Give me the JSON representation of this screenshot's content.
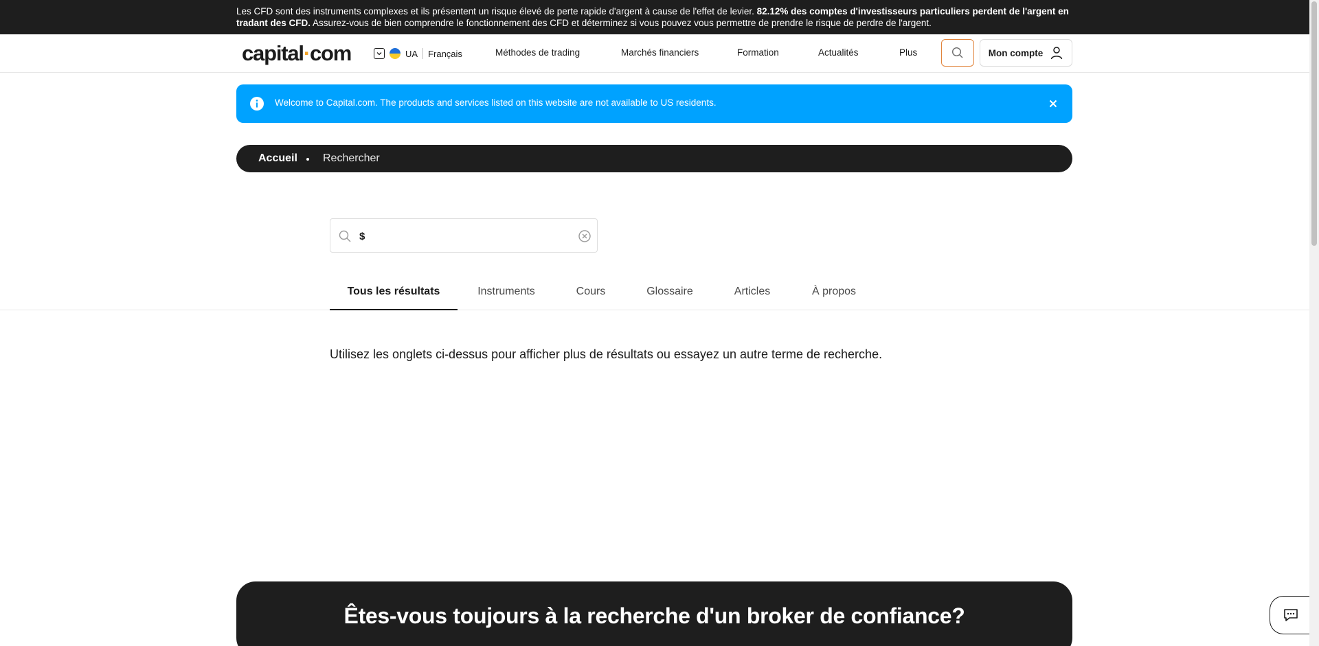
{
  "risk_warning": {
    "part1": "Les CFD sont des instruments complexes et ils présentent un risque élevé de perte rapide d'argent à cause de l'effet de levier. ",
    "bold": "82.12% des comptes d'investisseurs particuliers perdent de l'argent en tradant des CFD.",
    "part2": " Assurez-vous de bien comprendre le fonctionnement des CFD et déterminez si vous pouvez vous permettre de prendre le risque de perdre de l'argent."
  },
  "header": {
    "logo_main": "capital",
    "logo_dot": "·",
    "logo_end": "com",
    "region_code": "UA",
    "language": "Français",
    "nav": [
      "Méthodes de trading",
      "Marchés financiers",
      "Formation",
      "Actualités",
      "Plus"
    ],
    "account_label": "Mon compte"
  },
  "info_banner": {
    "text": "Welcome to Capital.com. The products and services listed on this website are not available to US residents."
  },
  "breadcrumb": {
    "home": "Accueil",
    "current": "Rechercher"
  },
  "search": {
    "value": "$"
  },
  "tabs": [
    {
      "label": "Tous les résultats",
      "active": true
    },
    {
      "label": "Instruments",
      "active": false
    },
    {
      "label": "Cours",
      "active": false
    },
    {
      "label": "Glossaire",
      "active": false
    },
    {
      "label": "Articles",
      "active": false
    },
    {
      "label": "À propos",
      "active": false
    }
  ],
  "hint": "Utilisez les onglets ci-dessus pour afficher plus de résultats ou essayez un autre terme de recherche.",
  "cta": {
    "title": "Êtes-vous toujours à la recherche d'un broker de confiance?"
  },
  "colors": {
    "accent": "#f4a326",
    "info_blue": "#00a2ff",
    "dark": "#1e1e1e"
  },
  "icons": {
    "search": "search-icon",
    "user": "user-icon",
    "info": "info-icon",
    "close": "close-icon",
    "clear": "clear-icon",
    "chat": "chat-icon",
    "chevron": "chevron-down-icon"
  }
}
